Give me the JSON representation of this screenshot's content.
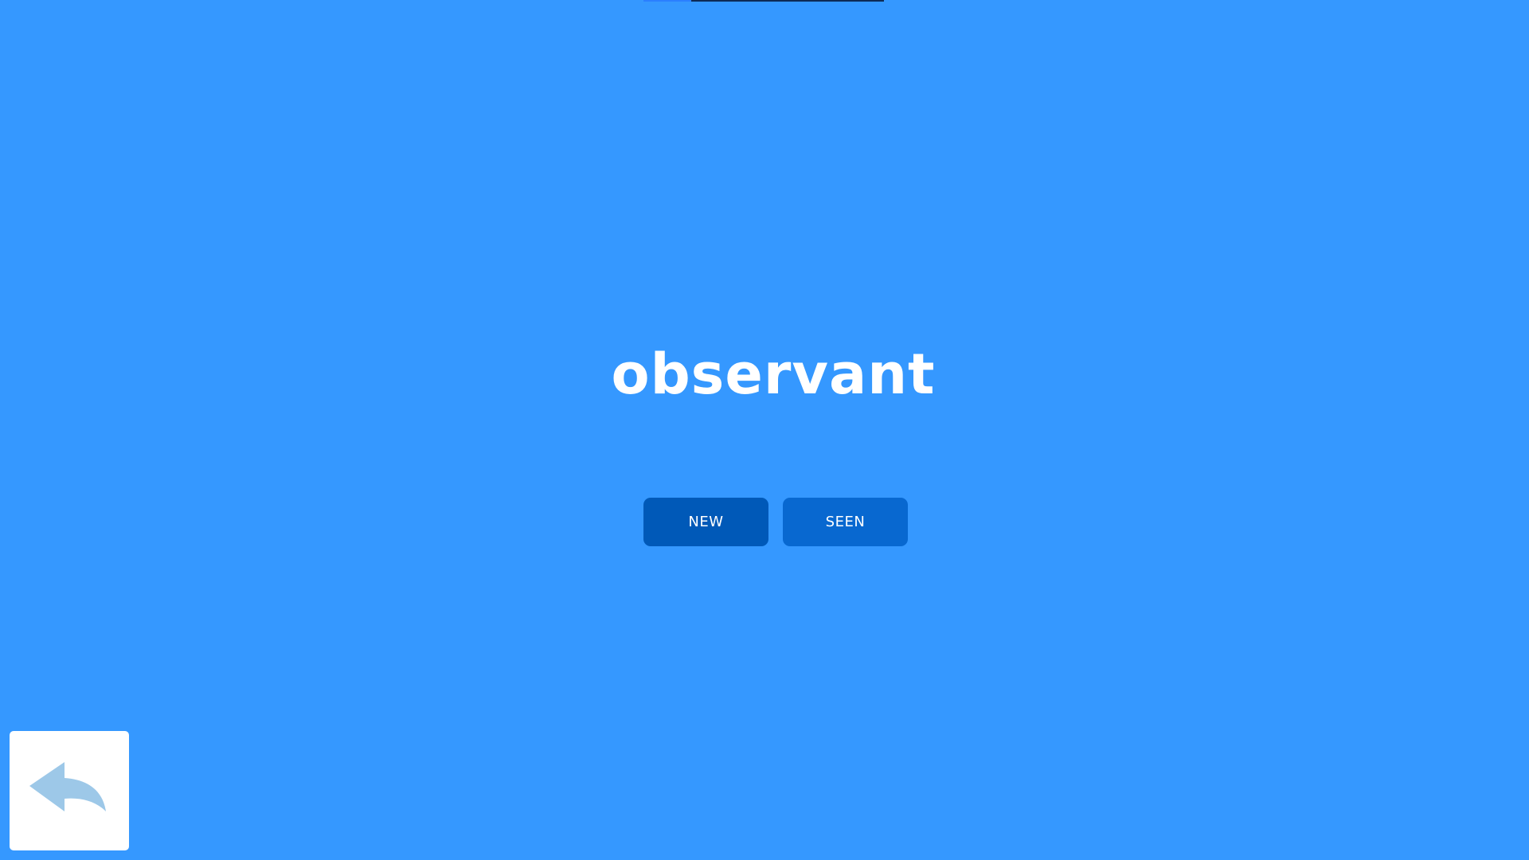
{
  "progress": {
    "fraction": 0.2
  },
  "trial": {
    "word": "observant"
  },
  "choices": {
    "new_label": "NEW",
    "seen_label": "SEEN"
  },
  "back": {
    "icon": "reply-arrow-icon"
  },
  "colors": {
    "background": "#3598ff",
    "new_button": "#0059b8",
    "seen_button": "#0868d0",
    "back_arrow": "#9dc8e8"
  }
}
